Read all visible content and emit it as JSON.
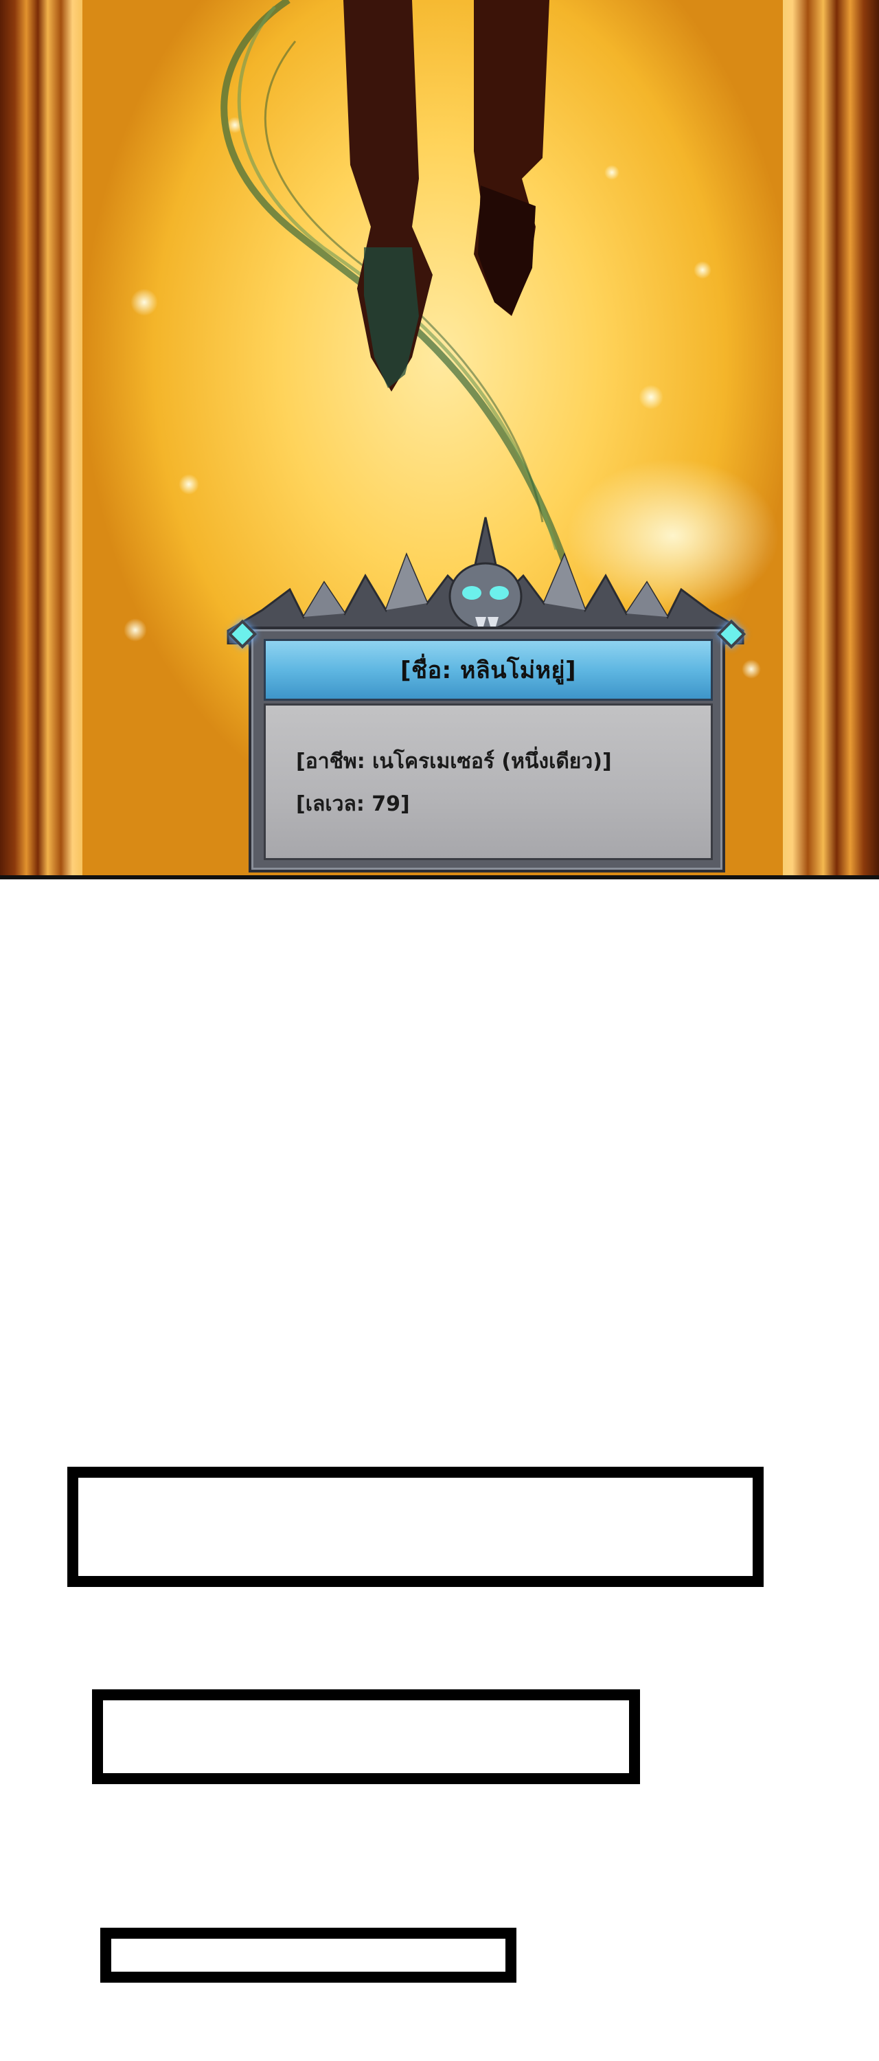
{
  "status_window": {
    "name_line": "[ชื่อ: หลินโม่หยู่]",
    "job_line": "[อาชีพ: เนโครเมเซอร์ (หนึ่งเดียว)]",
    "level_line": "[เลเวล: 79]"
  },
  "palette": {
    "background_glow": "#ffd35a",
    "title_bar": "#5fb7e2",
    "window_frame": "#5a5d66",
    "body_panel": "#b4b4b7",
    "skull_eyes": "#6cf0ec"
  }
}
